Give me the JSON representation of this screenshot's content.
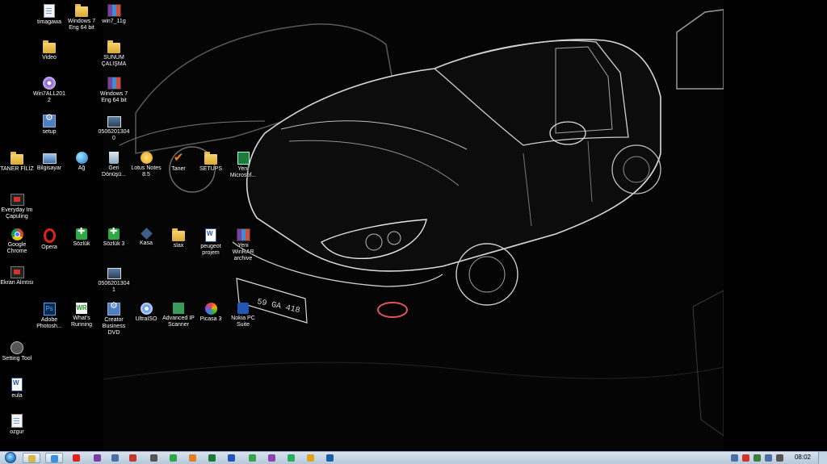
{
  "desktop": {
    "icons": [
      {
        "label": "timagawa",
        "glyph": "g-doc",
        "icon": "document-icon"
      },
      {
        "label": "Windows 7 Eng 64 bit",
        "glyph": "g-folder",
        "icon": "folder-icon"
      },
      {
        "label": "win7_11g",
        "glyph": "g-rar",
        "icon": "winrar-archive-icon"
      },
      {
        "label": "Video",
        "glyph": "g-folder",
        "icon": "folder-icon"
      },
      {
        "label": "SUNUM ÇALIŞMA",
        "glyph": "g-folder",
        "icon": "folder-icon"
      },
      {
        "label": "Win7ALL2012",
        "glyph": "g-disc",
        "icon": "disc-image-icon"
      },
      {
        "label": "Windows 7 Eng 64 bit",
        "glyph": "g-rar",
        "icon": "winrar-archive-icon"
      },
      {
        "label": "setup",
        "glyph": "g-setup",
        "icon": "setup-icon"
      },
      {
        "label": "05062013040",
        "glyph": "g-img",
        "icon": "image-file-icon"
      },
      {
        "label": "TANER FİLİZ",
        "glyph": "g-folder",
        "icon": "folder-icon"
      },
      {
        "label": "Bilgisayar",
        "glyph": "g-pc",
        "icon": "computer-icon"
      },
      {
        "label": "Ağ",
        "glyph": "g-globe",
        "icon": "network-icon"
      },
      {
        "label": "Geri Dönüşü...",
        "glyph": "g-recycle",
        "icon": "recycle-bin-icon"
      },
      {
        "label": "Lotus Notes 8.5",
        "glyph": "g-lotus",
        "icon": "lotus-notes-icon"
      },
      {
        "label": "Taner",
        "glyph": "g-check",
        "icon": "checkmark-icon"
      },
      {
        "label": "SETUPS",
        "glyph": "g-folder",
        "icon": "folder-icon"
      },
      {
        "label": "Yeni Microsof...",
        "glyph": "g-excel",
        "icon": "excel-file-icon"
      },
      {
        "label": "Everyday Im Çapuling",
        "glyph": "g-film",
        "icon": "video-file-icon"
      },
      {
        "label": "Google Chrome",
        "glyph": "g-chrome",
        "icon": "chrome-icon"
      },
      {
        "label": "Opera",
        "glyph": "g-opera",
        "icon": "opera-icon"
      },
      {
        "label": "Sözlük",
        "glyph": "g-sozluk",
        "icon": "dictionary-icon"
      },
      {
        "label": "Sözlük 3",
        "glyph": "g-sozluk",
        "icon": "dictionary-icon"
      },
      {
        "label": "Kasa",
        "glyph": "g-cube",
        "icon": "kasa-icon"
      },
      {
        "label": "slax",
        "glyph": "g-folder",
        "icon": "folder-icon"
      },
      {
        "label": "peugeot projem",
        "glyph": "g-word",
        "icon": "word-file-icon"
      },
      {
        "label": "Yeni WinRAR archive",
        "glyph": "g-rar",
        "icon": "winrar-archive-icon"
      },
      {
        "label": "Ekran Alıntısı",
        "glyph": "g-film",
        "icon": "snipping-tool-icon"
      },
      {
        "label": "05062013041",
        "glyph": "g-img",
        "icon": "image-file-icon"
      },
      {
        "label": "Adobe Photosh...",
        "glyph": "g-ps",
        "icon": "photoshop-icon"
      },
      {
        "label": "What's Running",
        "glyph": "g-wr",
        "icon": "whats-running-icon"
      },
      {
        "label": "Creator Business DVD",
        "glyph": "g-setup",
        "icon": "creator-dvd-icon"
      },
      {
        "label": "UltraISO",
        "glyph": "g-ultra",
        "icon": "ultraiso-icon"
      },
      {
        "label": "Advanced IP Scanner",
        "glyph": "g-scan",
        "icon": "ip-scanner-icon"
      },
      {
        "label": "Picasa 3",
        "glyph": "g-picasa",
        "icon": "picasa-icon"
      },
      {
        "label": "Nokia PC Suite",
        "glyph": "g-nokia",
        "icon": "nokia-pc-suite-icon"
      },
      {
        "label": "Setting Tool",
        "glyph": "g-tool",
        "icon": "setting-tool-icon"
      },
      {
        "label": "eula",
        "glyph": "g-word",
        "icon": "word-file-icon"
      },
      {
        "label": "ozgur",
        "glyph": "g-doc",
        "icon": "document-icon"
      }
    ]
  },
  "taskbar": {
    "start_icon": "windows-start-orb-icon",
    "pinned": [
      {
        "icon": "explorer-icon",
        "color": "#d9b44a"
      },
      {
        "icon": "internet-explorer-icon",
        "color": "#3d8fe0"
      },
      {
        "icon": "opera-icon",
        "color": "#e0221b"
      },
      {
        "icon": "winrar-icon",
        "color": "#7a3fa0"
      },
      {
        "icon": "window-icon",
        "color": "#4a6fa5"
      },
      {
        "icon": "media-icon",
        "color": "#c0392b"
      },
      {
        "icon": "app-icon",
        "color": "#555555"
      },
      {
        "icon": "sozluk-icon",
        "color": "#2fa843"
      },
      {
        "icon": "firefox-icon",
        "color": "#e67e22"
      },
      {
        "icon": "excel-icon",
        "color": "#1f7a3a"
      },
      {
        "icon": "nokia-icon",
        "color": "#2456b8"
      },
      {
        "icon": "excel-icon",
        "color": "#3aa24a"
      },
      {
        "icon": "onenote-icon",
        "color": "#8e44ad"
      },
      {
        "icon": "green-dot-icon",
        "color": "#27ae60"
      },
      {
        "icon": "chrome-icon",
        "color": "#e0a21b"
      },
      {
        "icon": "photoshop-icon",
        "color": "#1c5fa8"
      }
    ],
    "tray_icons": [
      "arrow-up-icon",
      "flag-icon",
      "security-icon",
      "network-icon",
      "volume-icon"
    ],
    "clock": "08:02"
  }
}
